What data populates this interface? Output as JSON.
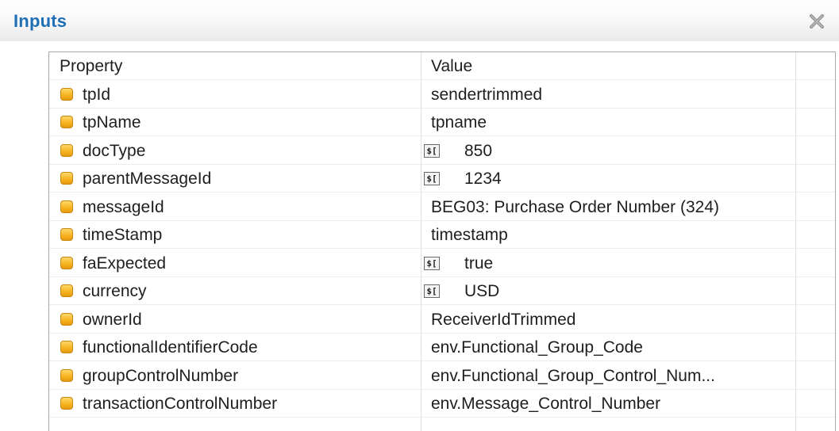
{
  "dialog": {
    "title": "Inputs",
    "close_icon": "close-x-icon"
  },
  "table": {
    "headers": {
      "property": "Property",
      "value": "Value"
    },
    "rows": [
      {
        "property": "tpId",
        "value": "sendertrimmed",
        "value_is_expression": false
      },
      {
        "property": "tpName",
        "value": "tpname",
        "value_is_expression": false
      },
      {
        "property": "docType",
        "value": "850",
        "value_is_expression": true
      },
      {
        "property": "parentMessageId",
        "value": "1234",
        "value_is_expression": true
      },
      {
        "property": "messageId",
        "value": "BEG03: Purchase Order Number (324)",
        "value_is_expression": false
      },
      {
        "property": "timeStamp",
        "value": "timestamp",
        "value_is_expression": false
      },
      {
        "property": "faExpected",
        "value": "true",
        "value_is_expression": true
      },
      {
        "property": "currency",
        "value": "USD",
        "value_is_expression": true
      },
      {
        "property": "ownerId",
        "value": "ReceiverIdTrimmed",
        "value_is_expression": false
      },
      {
        "property": "functionalIdentifierCode",
        "value": "env.Functional_Group_Code",
        "value_is_expression": false
      },
      {
        "property": "groupControlNumber",
        "value": "env.Functional_Group_Control_Num...",
        "value_is_expression": false
      },
      {
        "property": "transactionControlNumber",
        "value": "env.Message_Control_Number",
        "value_is_expression": false
      }
    ],
    "property_icon": "property-folder-icon",
    "expression_icon": "expression-icon"
  },
  "colors": {
    "title": "#1f6fb5",
    "property_icon": "#f6b21e",
    "grid": "#a9a9a9"
  }
}
